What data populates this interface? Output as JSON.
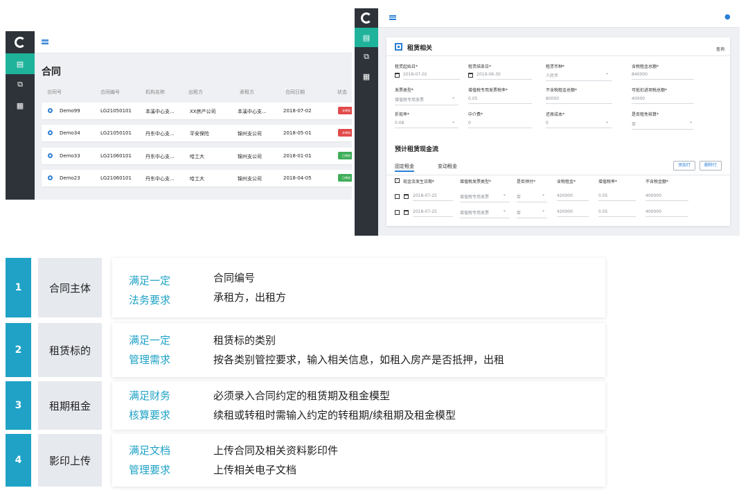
{
  "contracts": {
    "title": "合同",
    "columns": [
      "合同号",
      "合同编号",
      "机构名称",
      "出租方",
      "承租方",
      "合同日期",
      "状态"
    ],
    "rows": [
      {
        "id": "Demo99",
        "no": "LG21050101",
        "org": "本溪中心支...",
        "lessor": "XX房产公司",
        "lessee": "本溪中心支...",
        "date": "2018-07-02",
        "status": "未审核",
        "status_color": "#e24a4a"
      },
      {
        "id": "Demo34",
        "no": "LG21050101",
        "org": "丹东中心支...",
        "lessor": "平安保险",
        "lessee": "锦州支公司",
        "date": "2018-05-01",
        "status": "未审核",
        "status_color": "#e24a4a"
      },
      {
        "id": "Demo33",
        "no": "LG21060101",
        "org": "丹东中心支...",
        "lessor": "哈工大",
        "lessee": "锦州支公司",
        "date": "2018-01-01",
        "status": "已审核",
        "status_color": "#3fae5a"
      },
      {
        "id": "Demo23",
        "no": "LG21060101",
        "org": "丹东中心支...",
        "lessor": "哈工大",
        "lessee": "锦州支公司",
        "date": "2018-04-05",
        "status": "已审核",
        "status_color": "#3fae5a"
      }
    ]
  },
  "lease": {
    "title": "租赁相关",
    "query_link": "查询",
    "fields": {
      "start_date": {
        "label": "租赁起始日*",
        "value": "2018-07-01"
      },
      "end_date": {
        "label": "租赁结束日*",
        "value": "2019-06-30"
      },
      "currency": {
        "label": "租赁币种*",
        "value": "人民币"
      },
      "total_rent": {
        "label": "含税租金总额*",
        "value": "840000"
      },
      "invoice_type": {
        "label": "发票类型*",
        "value": "增值税专用发票"
      },
      "vat_rate": {
        "label": "增值税专用发票税率*",
        "value": "0.05"
      },
      "rent_ex_tax": {
        "label": "不含税租金总额*",
        "value": "80000"
      },
      "deductible_tax": {
        "label": "可抵扣进项税总额*",
        "value": "40000"
      },
      "discount_rate": {
        "label": "折现率*",
        "value": "0.08"
      },
      "agent_fee": {
        "label": "中介费*",
        "value": "0"
      },
      "restore_cost": {
        "label": "还原成本*",
        "value": "0"
      },
      "rent_free": {
        "label": "是否租免核算*",
        "value": "否"
      }
    },
    "cashflow": {
      "title": "预计租赁现金流",
      "tabs": [
        "固定租金",
        "变动租金"
      ],
      "add_row": "添加行",
      "delete_row": "删除行",
      "columns": [
        "现金流发生日期*",
        "增值税发票类型*",
        "是否预付*",
        "含税租金*",
        "增值税率*",
        "不含税金额*"
      ],
      "rows": [
        {
          "date": "2018-07-25",
          "invoice": "增值税专用发票",
          "prepaid": "否",
          "rent": "420000",
          "rate": "0.05",
          "net": "400000"
        },
        {
          "date": "2018-07-25",
          "invoice": "增值税专用发票",
          "prepaid": "否",
          "rent": "420000",
          "rate": "0.05",
          "net": "400000"
        }
      ]
    }
  },
  "requirements": [
    {
      "no": "1",
      "category": "合同主体",
      "need": [
        "满足一定",
        "法务要求"
      ],
      "details": [
        "合同编号",
        "承租方，出租方"
      ]
    },
    {
      "no": "2",
      "category": "租赁标的",
      "need": [
        "满足一定",
        "管理需求"
      ],
      "details": [
        "租赁标的类别",
        "按各类别管控要求，输入相关信息，如租入房产是否抵押，出租"
      ]
    },
    {
      "no": "3",
      "category": "租期租金",
      "need": [
        "满足财务",
        "核算要求"
      ],
      "details": [
        "必须录入合同约定的租赁期及租金模型",
        "续租或转租时需输入约定的转租期/续租期及租金模型"
      ]
    },
    {
      "no": "4",
      "category": "影印上传",
      "need": [
        "满足文档",
        "管理要求"
      ],
      "details": [
        "上传合同及相关资料影印件",
        "上传相关电子文档"
      ]
    }
  ],
  "colors": {
    "accent": "#1fa2c6",
    "nav_active": "#1fb39b",
    "nav_bg": "#2d3339",
    "link": "#2a7fd4"
  }
}
